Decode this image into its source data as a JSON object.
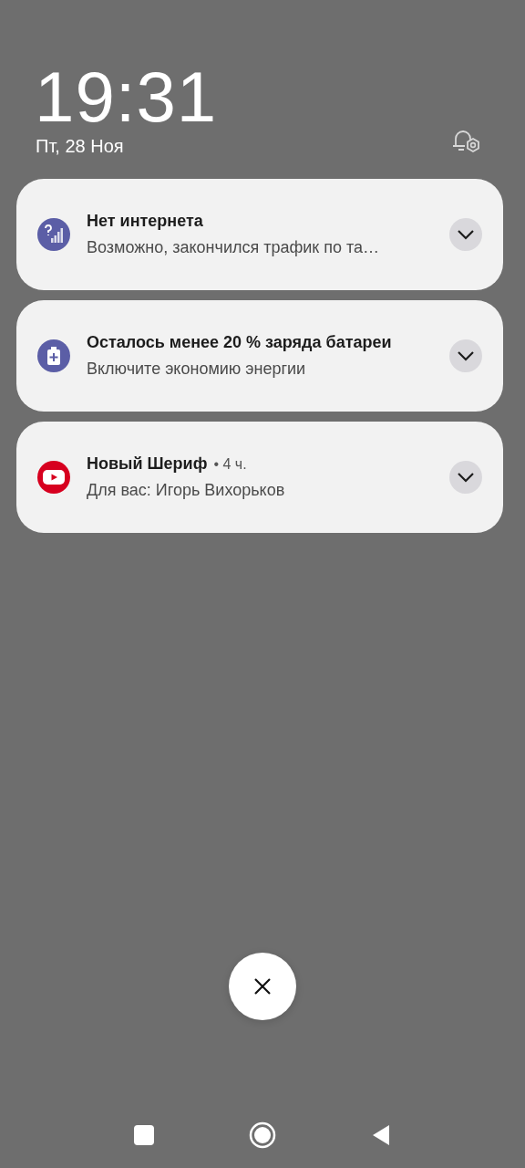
{
  "lock_screen": {
    "time": "19:31",
    "date": "Пт, 28 Ноя"
  },
  "notifications": [
    {
      "kind": "network",
      "color": "#5b5ea6",
      "title": "Нет интернета",
      "text": "Возможно, закончился трафик по та…"
    },
    {
      "kind": "battery",
      "color": "#5b5ea6",
      "title": "Осталось менее 20 % заряда батареи",
      "text": "Включите экономию энергии"
    },
    {
      "kind": "video",
      "color": "#d7001f",
      "title": "Новый Шериф",
      "time": "• 4 ч.",
      "text": "Для вас: Игорь Вихорьков"
    }
  ]
}
